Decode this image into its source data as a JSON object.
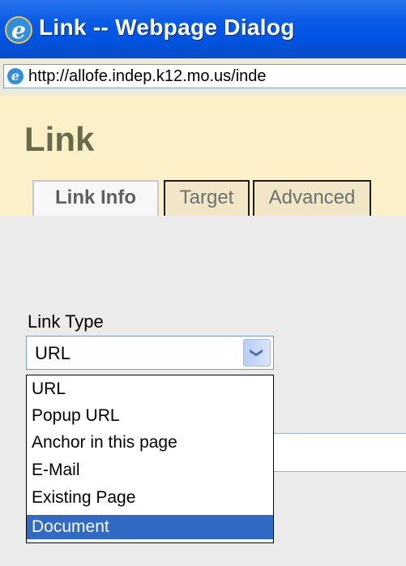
{
  "window": {
    "title": "Link -- Webpage Dialog",
    "address": "http://allofe.indep.k12.mo.us/inde"
  },
  "dialog": {
    "title": "Link",
    "tabs": [
      {
        "label": "Link Info",
        "active": true
      },
      {
        "label": "Target",
        "active": false
      },
      {
        "label": "Advanced",
        "active": false
      }
    ]
  },
  "link_type": {
    "label": "Link Type",
    "value": "URL",
    "options": [
      "URL",
      "Popup URL",
      "Anchor in this page",
      "E-Mail",
      "Existing Page",
      "Document"
    ],
    "highlighted": "Document"
  },
  "icons": {
    "window_icon": "ie-icon",
    "address_icon": "ie-icon",
    "dropdown_arrow": "chevron-down-icon"
  },
  "colors": {
    "title_bar": "#0054e3",
    "header_bg": "#fcf0c8",
    "highlight": "#316ac5"
  }
}
